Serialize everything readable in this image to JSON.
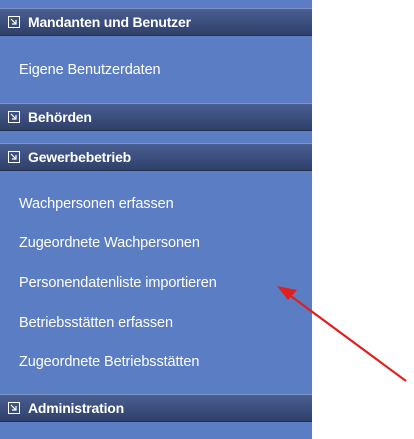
{
  "sections": [
    {
      "label": "Mandanten und Benutzer"
    },
    {
      "label": "Behörden"
    },
    {
      "label": "Gewerbebetrieb"
    },
    {
      "label": "Administration"
    }
  ],
  "items": [
    {
      "label": "Eigene Benutzerdaten"
    },
    {
      "label": "Wachpersonen erfassen"
    },
    {
      "label": "Zugeordnete Wachpersonen"
    },
    {
      "label": "Personendatenliste importieren"
    },
    {
      "label": "Betriebsstätten erfassen"
    },
    {
      "label": "Zugeordnete Betriebsstätten"
    }
  ],
  "icons": {
    "section_toggle": "collapse-arrow-icon",
    "annotation": "red-arrow-icon"
  },
  "colors": {
    "nav_background": "#5b7dc4",
    "section_header": "#3a4d7c",
    "text": "#ffffff",
    "annotation_arrow": "#e02020"
  }
}
